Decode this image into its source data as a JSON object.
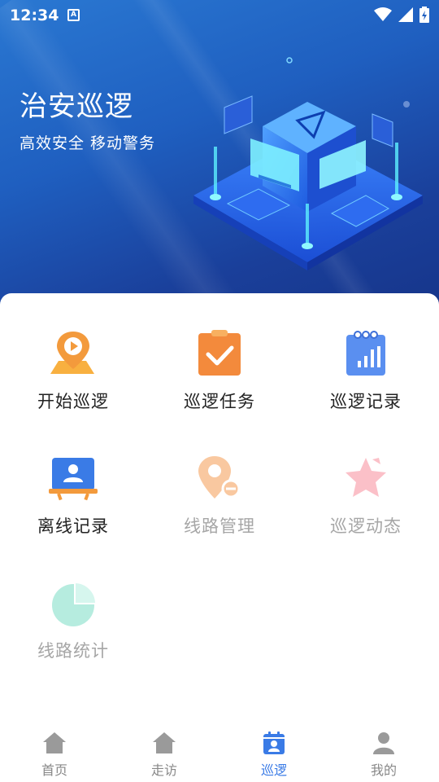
{
  "status_bar": {
    "time": "12:34",
    "notification_icon_text": "A"
  },
  "banner": {
    "title": "治安巡逻",
    "subtitle": "高效安全  移动警务"
  },
  "menu": {
    "items": [
      {
        "label": "开始巡逻",
        "icon": "map-pin-play-icon",
        "enabled": true
      },
      {
        "label": "巡逻任务",
        "icon": "clipboard-check-icon",
        "enabled": true
      },
      {
        "label": "巡逻记录",
        "icon": "calendar-chart-icon",
        "enabled": true
      },
      {
        "label": "离线记录",
        "icon": "board-user-icon",
        "enabled": true
      },
      {
        "label": "线路管理",
        "icon": "route-pin-icon",
        "enabled": false
      },
      {
        "label": "巡逻动态",
        "icon": "star-icon",
        "enabled": false
      },
      {
        "label": "线路统计",
        "icon": "pie-chart-icon",
        "enabled": false
      }
    ]
  },
  "bottom_nav": {
    "items": [
      {
        "label": "首页",
        "icon": "home-icon",
        "active": false
      },
      {
        "label": "走访",
        "icon": "house-icon",
        "active": false
      },
      {
        "label": "巡逻",
        "icon": "calendar-user-icon",
        "active": true
      },
      {
        "label": "我的",
        "icon": "person-icon",
        "active": false
      }
    ]
  },
  "colors": {
    "accent": "#3a7be6",
    "banner_top": "#2a78d2",
    "banner_bottom": "#16358a",
    "orange": "#f39a3c",
    "disabled_text": "#a6a6a6"
  }
}
